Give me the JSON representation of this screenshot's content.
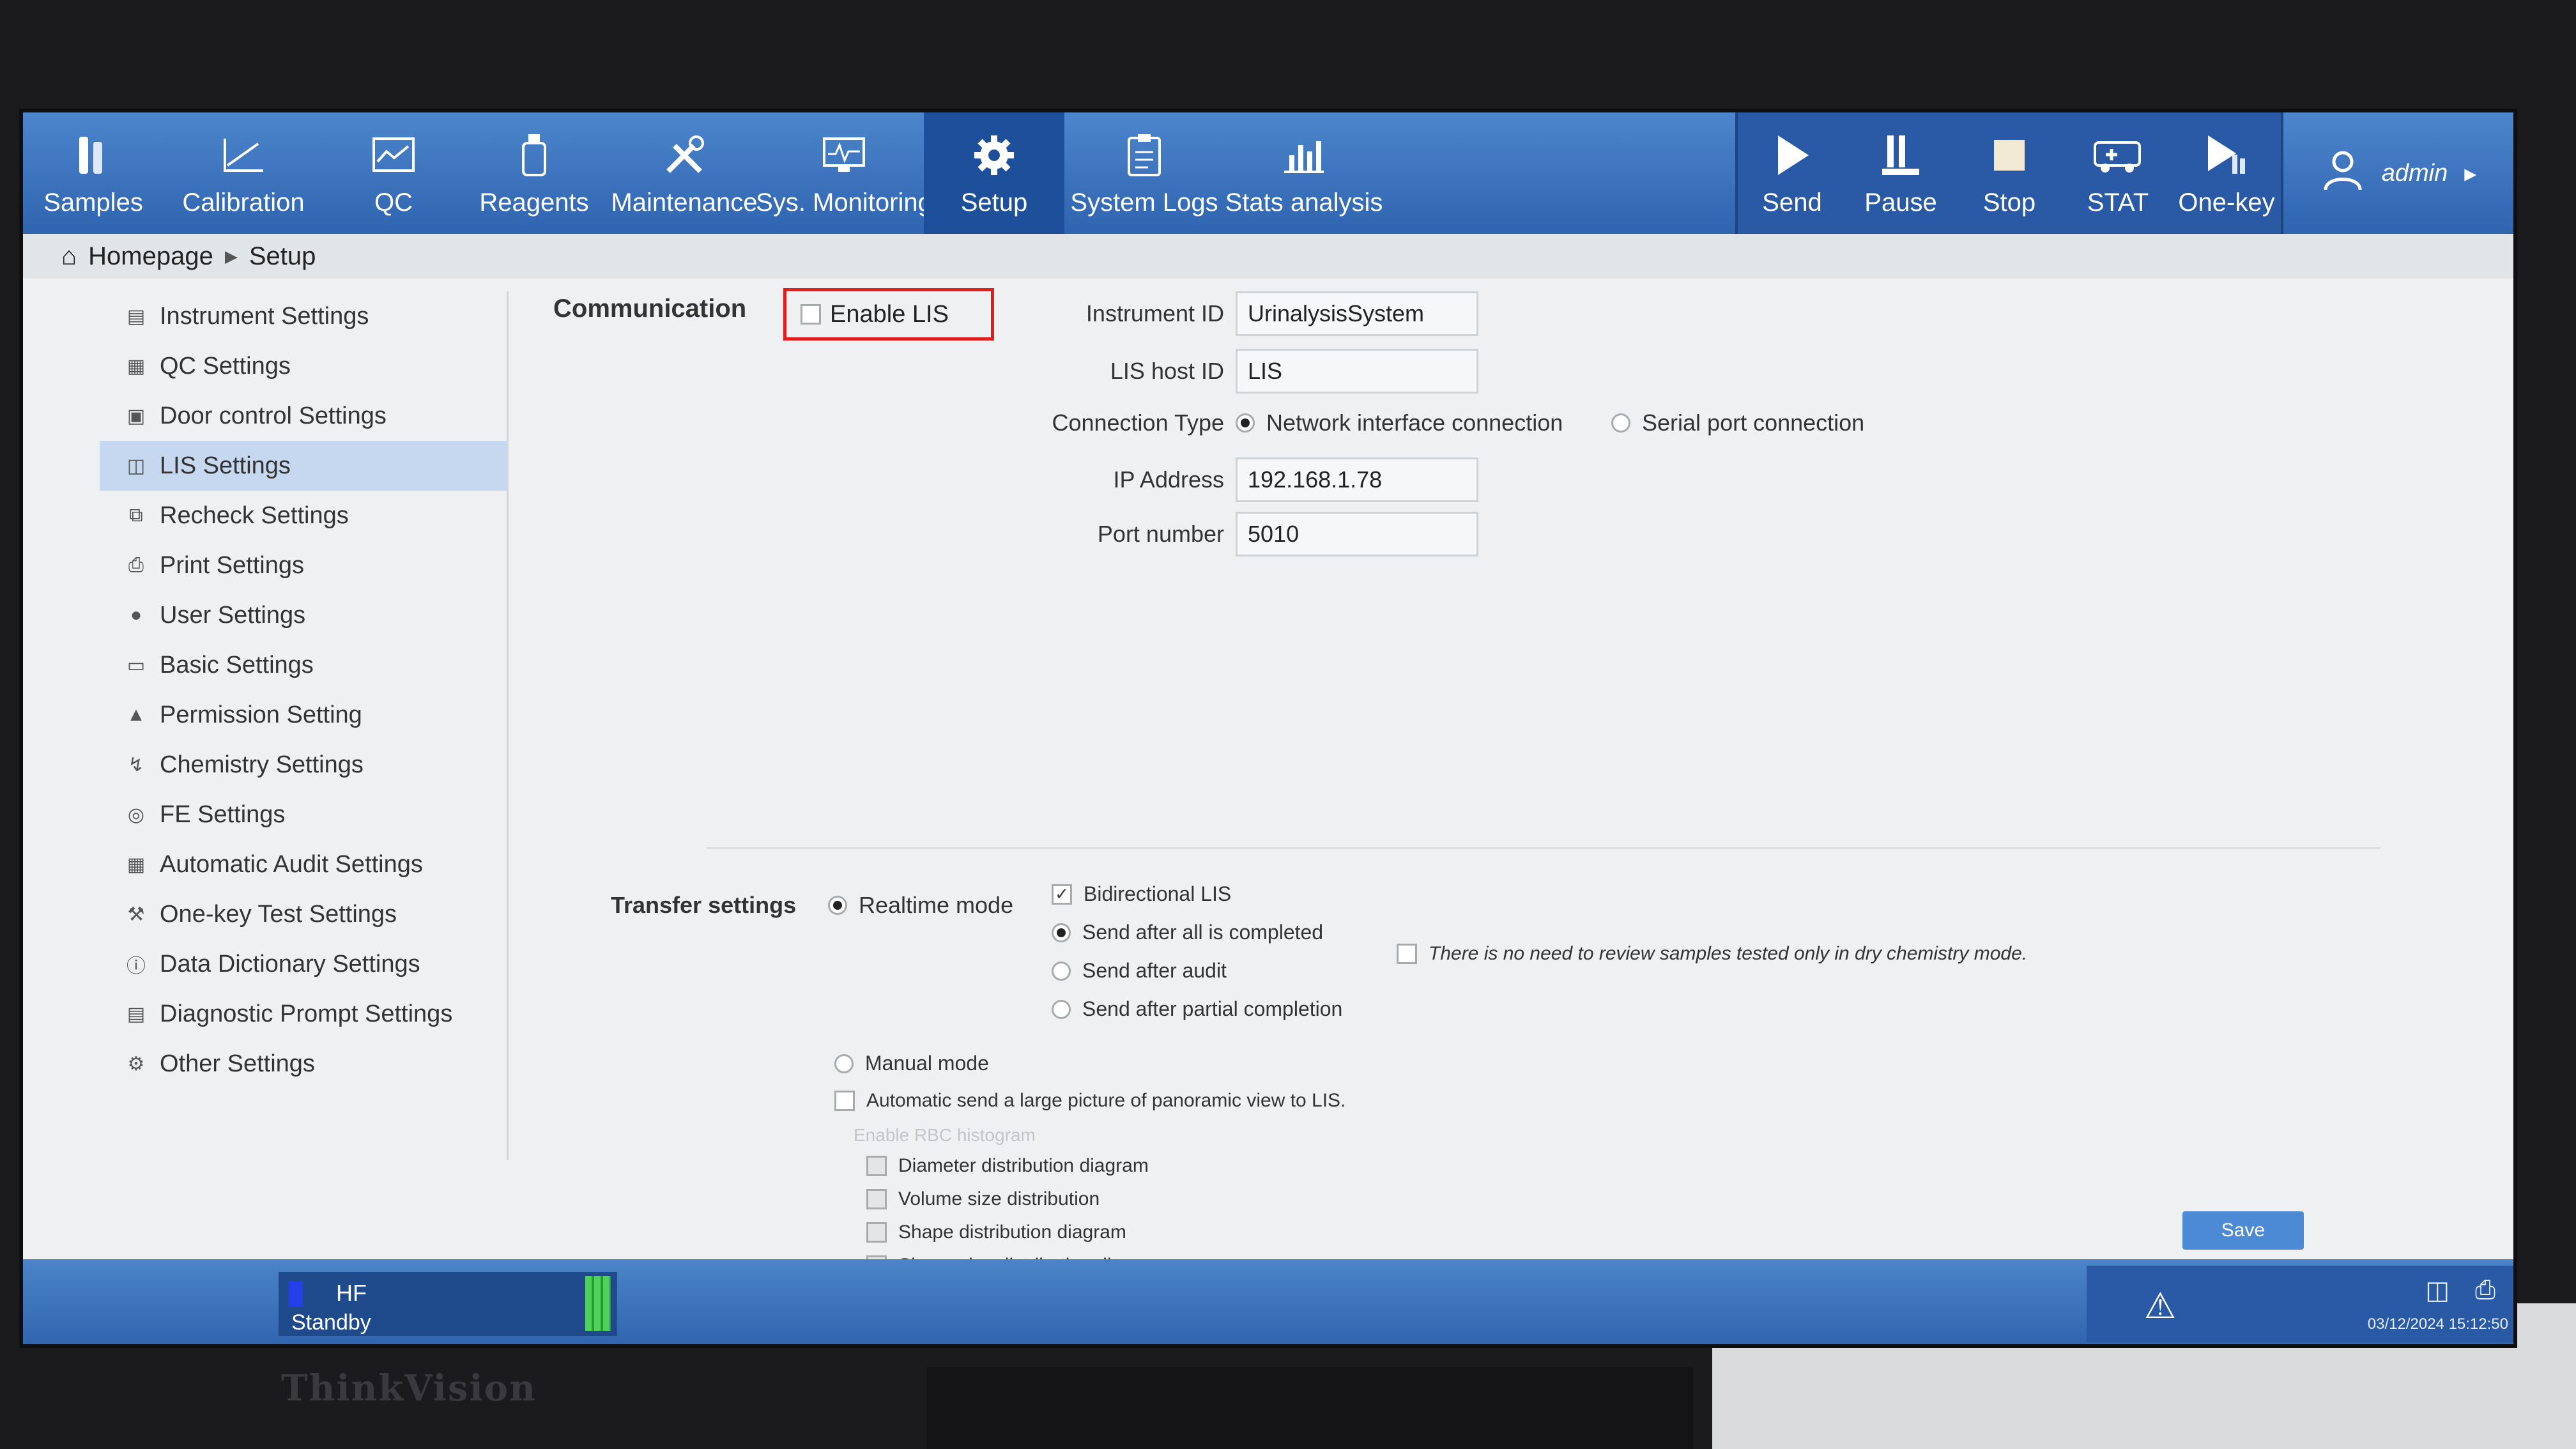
{
  "monitor_brand": "ThinkVision",
  "toolbar": {
    "tabs": [
      {
        "label": "Samples",
        "icon": "sample-tubes-icon"
      },
      {
        "label": "Calibration",
        "icon": "calibration-chart-icon"
      },
      {
        "label": "QC",
        "icon": "qc-chart-icon"
      },
      {
        "label": "Reagents",
        "icon": "reagent-bottle-icon"
      },
      {
        "label": "Maintenance",
        "icon": "tools-icon"
      },
      {
        "label": "Sys. Monitoring",
        "icon": "monitor-waveform-icon"
      },
      {
        "label": "Setup",
        "icon": "gear-icon"
      },
      {
        "label": "System Logs",
        "icon": "clipboard-icon"
      },
      {
        "label": "Stats analysis",
        "icon": "bar-chart-icon"
      }
    ],
    "actions": [
      {
        "label": "Send",
        "icon": "play-icon"
      },
      {
        "label": "Pause",
        "icon": "pause-icon"
      },
      {
        "label": "Stop",
        "icon": "stop-icon"
      },
      {
        "label": "STAT",
        "icon": "ambulance-icon"
      },
      {
        "label": "One-key",
        "icon": "one-key-icon"
      }
    ],
    "user": "admin"
  },
  "breadcrumb": {
    "home": "Homepage",
    "current": "Setup"
  },
  "sidebar": {
    "items": [
      {
        "label": "Instrument Settings"
      },
      {
        "label": "QC Settings"
      },
      {
        "label": "Door control Settings"
      },
      {
        "label": "LIS Settings"
      },
      {
        "label": "Recheck Settings"
      },
      {
        "label": "Print Settings"
      },
      {
        "label": "User Settings"
      },
      {
        "label": "Basic Settings"
      },
      {
        "label": "Permission Setting"
      },
      {
        "label": "Chemistry Settings"
      },
      {
        "label": "FE Settings"
      },
      {
        "label": "Automatic Audit Settings"
      },
      {
        "label": "One-key Test Settings"
      },
      {
        "label": "Data Dictionary Settings"
      },
      {
        "label": "Diagnostic Prompt Settings"
      },
      {
        "label": "Other Settings"
      }
    ],
    "active_index": 3
  },
  "communication": {
    "title": "Communication",
    "enable_lis_label": "Enable LIS",
    "instrument_id_label": "Instrument ID",
    "instrument_id_value": "UrinalysisSystem",
    "lis_host_id_label": "LIS host ID",
    "lis_host_id_value": "LIS",
    "connection_type_label": "Connection Type",
    "network_option": "Network interface connection",
    "serial_option": "Serial port connection",
    "ip_label": "IP Address",
    "ip_value": "192.168.1.78",
    "port_label": "Port number",
    "port_value": "5010"
  },
  "transfer": {
    "title": "Transfer settings",
    "realtime_mode": "Realtime mode",
    "bidirectional": "Bidirectional LIS",
    "send_after_all": "Send after all is completed",
    "send_after_audit": "Send after audit",
    "send_after_partial": "Send after partial completion",
    "no_review_note": "There is no need to review samples tested only in dry chemistry mode.",
    "manual_mode": "Manual mode",
    "auto_send_picture": "Automatic send a large picture of panoramic view to LIS.",
    "enable_rbc": "Enable RBC histogram",
    "diameter": "Diameter distribution diagram",
    "volume": "Volume size distribution",
    "shape": "Shape distribution diagram",
    "shape_size": "Shape size distribution diagram"
  },
  "save_label": "Save",
  "status": {
    "hf": "HF",
    "state": "Standby",
    "datetime": "03/12/2024 15:12:50"
  }
}
